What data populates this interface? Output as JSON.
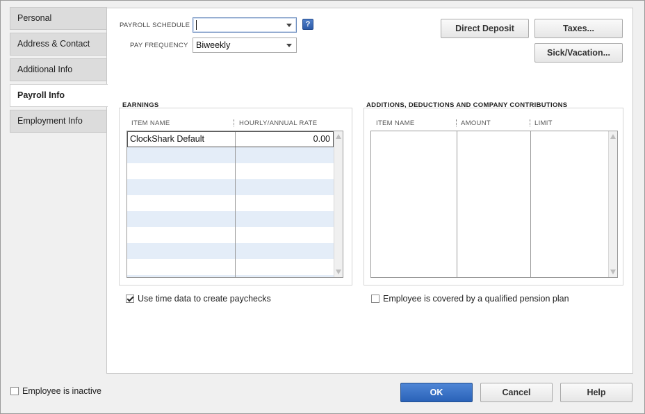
{
  "tabs": [
    {
      "label": "Personal"
    },
    {
      "label": "Address & Contact"
    },
    {
      "label": "Additional Info"
    },
    {
      "label": "Payroll Info",
      "active": true
    },
    {
      "label": "Employment Info"
    }
  ],
  "payroll": {
    "schedule_label": "PAYROLL SCHEDULE",
    "schedule_value": "",
    "help_label": "?",
    "frequency_label": "PAY FREQUENCY",
    "frequency_value": "Biweekly"
  },
  "buttons": {
    "direct_deposit": "Direct Deposit",
    "taxes": "Taxes...",
    "sick_vacation": "Sick/Vacation...",
    "ok": "OK",
    "cancel": "Cancel",
    "help": "Help"
  },
  "earnings": {
    "title": "EARNINGS",
    "columns": [
      "ITEM NAME",
      "HOURLY/ANNUAL RATE"
    ],
    "rows": [
      {
        "item": "ClockShark Default",
        "rate": "0.00"
      }
    ]
  },
  "additions": {
    "title": "ADDITIONS, DEDUCTIONS AND COMPANY CONTRIBUTIONS",
    "columns": [
      "ITEM NAME",
      "AMOUNT",
      "LIMIT"
    ]
  },
  "checkboxes": {
    "use_time_data": {
      "label": "Use time data to create paychecks",
      "checked": true
    },
    "pension_plan": {
      "label": "Employee is covered by a qualified pension plan",
      "checked": false
    },
    "inactive": {
      "label": "Employee is inactive",
      "checked": false
    }
  }
}
